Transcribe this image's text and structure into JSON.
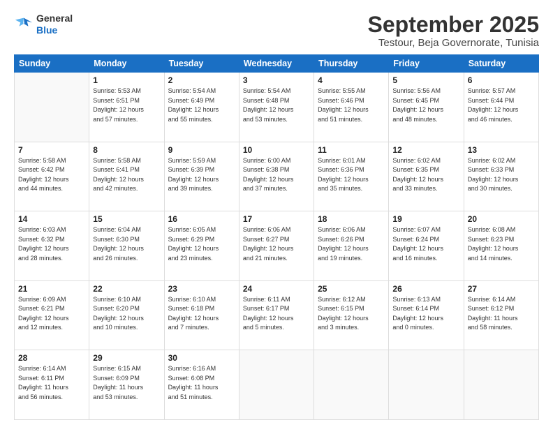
{
  "logo": {
    "line1": "General",
    "line2": "Blue"
  },
  "title": "September 2025",
  "subtitle": "Testour, Beja Governorate, Tunisia",
  "days_of_week": [
    "Sunday",
    "Monday",
    "Tuesday",
    "Wednesday",
    "Thursday",
    "Friday",
    "Saturday"
  ],
  "weeks": [
    [
      {
        "day": "",
        "info": ""
      },
      {
        "day": "1",
        "info": "Sunrise: 5:53 AM\nSunset: 6:51 PM\nDaylight: 12 hours\nand 57 minutes."
      },
      {
        "day": "2",
        "info": "Sunrise: 5:54 AM\nSunset: 6:49 PM\nDaylight: 12 hours\nand 55 minutes."
      },
      {
        "day": "3",
        "info": "Sunrise: 5:54 AM\nSunset: 6:48 PM\nDaylight: 12 hours\nand 53 minutes."
      },
      {
        "day": "4",
        "info": "Sunrise: 5:55 AM\nSunset: 6:46 PM\nDaylight: 12 hours\nand 51 minutes."
      },
      {
        "day": "5",
        "info": "Sunrise: 5:56 AM\nSunset: 6:45 PM\nDaylight: 12 hours\nand 48 minutes."
      },
      {
        "day": "6",
        "info": "Sunrise: 5:57 AM\nSunset: 6:44 PM\nDaylight: 12 hours\nand 46 minutes."
      }
    ],
    [
      {
        "day": "7",
        "info": "Sunrise: 5:58 AM\nSunset: 6:42 PM\nDaylight: 12 hours\nand 44 minutes."
      },
      {
        "day": "8",
        "info": "Sunrise: 5:58 AM\nSunset: 6:41 PM\nDaylight: 12 hours\nand 42 minutes."
      },
      {
        "day": "9",
        "info": "Sunrise: 5:59 AM\nSunset: 6:39 PM\nDaylight: 12 hours\nand 39 minutes."
      },
      {
        "day": "10",
        "info": "Sunrise: 6:00 AM\nSunset: 6:38 PM\nDaylight: 12 hours\nand 37 minutes."
      },
      {
        "day": "11",
        "info": "Sunrise: 6:01 AM\nSunset: 6:36 PM\nDaylight: 12 hours\nand 35 minutes."
      },
      {
        "day": "12",
        "info": "Sunrise: 6:02 AM\nSunset: 6:35 PM\nDaylight: 12 hours\nand 33 minutes."
      },
      {
        "day": "13",
        "info": "Sunrise: 6:02 AM\nSunset: 6:33 PM\nDaylight: 12 hours\nand 30 minutes."
      }
    ],
    [
      {
        "day": "14",
        "info": "Sunrise: 6:03 AM\nSunset: 6:32 PM\nDaylight: 12 hours\nand 28 minutes."
      },
      {
        "day": "15",
        "info": "Sunrise: 6:04 AM\nSunset: 6:30 PM\nDaylight: 12 hours\nand 26 minutes."
      },
      {
        "day": "16",
        "info": "Sunrise: 6:05 AM\nSunset: 6:29 PM\nDaylight: 12 hours\nand 23 minutes."
      },
      {
        "day": "17",
        "info": "Sunrise: 6:06 AM\nSunset: 6:27 PM\nDaylight: 12 hours\nand 21 minutes."
      },
      {
        "day": "18",
        "info": "Sunrise: 6:06 AM\nSunset: 6:26 PM\nDaylight: 12 hours\nand 19 minutes."
      },
      {
        "day": "19",
        "info": "Sunrise: 6:07 AM\nSunset: 6:24 PM\nDaylight: 12 hours\nand 16 minutes."
      },
      {
        "day": "20",
        "info": "Sunrise: 6:08 AM\nSunset: 6:23 PM\nDaylight: 12 hours\nand 14 minutes."
      }
    ],
    [
      {
        "day": "21",
        "info": "Sunrise: 6:09 AM\nSunset: 6:21 PM\nDaylight: 12 hours\nand 12 minutes."
      },
      {
        "day": "22",
        "info": "Sunrise: 6:10 AM\nSunset: 6:20 PM\nDaylight: 12 hours\nand 10 minutes."
      },
      {
        "day": "23",
        "info": "Sunrise: 6:10 AM\nSunset: 6:18 PM\nDaylight: 12 hours\nand 7 minutes."
      },
      {
        "day": "24",
        "info": "Sunrise: 6:11 AM\nSunset: 6:17 PM\nDaylight: 12 hours\nand 5 minutes."
      },
      {
        "day": "25",
        "info": "Sunrise: 6:12 AM\nSunset: 6:15 PM\nDaylight: 12 hours\nand 3 minutes."
      },
      {
        "day": "26",
        "info": "Sunrise: 6:13 AM\nSunset: 6:14 PM\nDaylight: 12 hours\nand 0 minutes."
      },
      {
        "day": "27",
        "info": "Sunrise: 6:14 AM\nSunset: 6:12 PM\nDaylight: 11 hours\nand 58 minutes."
      }
    ],
    [
      {
        "day": "28",
        "info": "Sunrise: 6:14 AM\nSunset: 6:11 PM\nDaylight: 11 hours\nand 56 minutes."
      },
      {
        "day": "29",
        "info": "Sunrise: 6:15 AM\nSunset: 6:09 PM\nDaylight: 11 hours\nand 53 minutes."
      },
      {
        "day": "30",
        "info": "Sunrise: 6:16 AM\nSunset: 6:08 PM\nDaylight: 11 hours\nand 51 minutes."
      },
      {
        "day": "",
        "info": ""
      },
      {
        "day": "",
        "info": ""
      },
      {
        "day": "",
        "info": ""
      },
      {
        "day": "",
        "info": ""
      }
    ]
  ]
}
